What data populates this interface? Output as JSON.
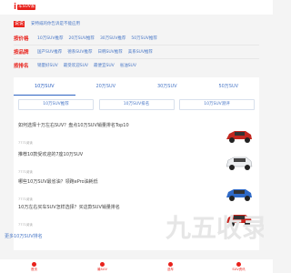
{
  "header": {
    "logo_mark": "i",
    "logo_text": "车SUV家"
  },
  "notice": {
    "badge": "说说",
    "text": "安特威的你告诉是不能应用"
  },
  "nav": [
    {
      "category": "按价格",
      "links": [
        "10万SUV推荐",
        "20万SUV推荐",
        "30万SUV推荐",
        "50万SUV推荐"
      ]
    },
    {
      "category": "按品牌",
      "links": [
        "国产SUV推荐",
        "德系SUV推荐",
        "日韩SUV推荐",
        "美系SUV推荐"
      ]
    },
    {
      "category": "按排名",
      "links": [
        "销量好SUV",
        "最受欢迎SUV",
        "最便宜SUV",
        "省油SUV"
      ]
    }
  ],
  "tabs": [
    "10万SUV",
    "20万SUV",
    "30万SUV",
    "50万SUV"
  ],
  "subtabs": [
    "10万SUV推荐",
    "10万SUV排名",
    "10万SUV测评"
  ],
  "articles": [
    {
      "title": "如何选择十万左右SUV？盘点10万SUV销量排名Top10",
      "meta": "7771阅读"
    },
    {
      "title": "推荐10款受欢迎的7座10万SUV",
      "meta": "7771阅读"
    },
    {
      "title": "哪些10万SUV最省油？领跑ePro油耗低",
      "meta": "7771阅读"
    },
    {
      "title": "10万左右买车SUV怎样选择？买这款SUV销量排名",
      "meta": "7771阅读"
    }
  ],
  "more_link": "更多10万SUV排名",
  "watermark": "九五收录",
  "footer": [
    "首页",
    "最SUV",
    "选车",
    "SUV资讯"
  ],
  "colors": {
    "brand_red": "#e8221c",
    "link_blue": "#4a78c7"
  }
}
